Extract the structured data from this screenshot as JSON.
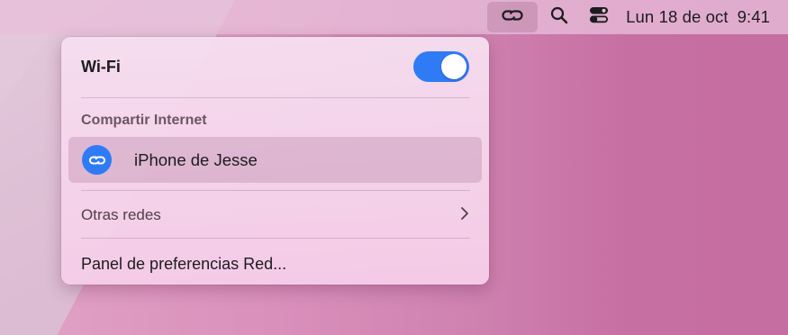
{
  "menubar": {
    "clock": {
      "date": "Lun 18 de oct",
      "time": "9:41"
    },
    "icons": [
      "personal-hotspot-icon",
      "search-icon",
      "control-center-icon"
    ]
  },
  "wifi_menu": {
    "wifi": {
      "label": "Wi-Fi",
      "enabled": true
    },
    "hotspot_section": {
      "title": "Compartir Internet",
      "devices": [
        {
          "name": "iPhone de Jesse",
          "icon": "link-icon"
        }
      ]
    },
    "other_networks": {
      "label": "Otras redes"
    },
    "preferences": {
      "label": "Panel de preferencias Red..."
    }
  },
  "colors": {
    "accent": "#2f7bf5",
    "desktop": "#c773a3"
  }
}
